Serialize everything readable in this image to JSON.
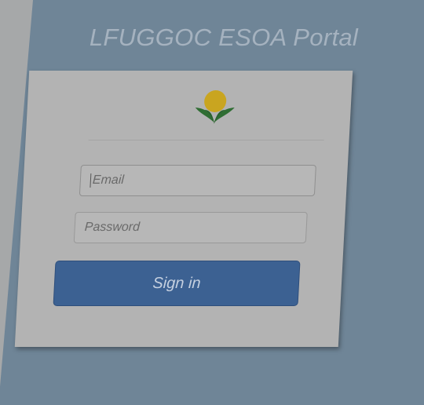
{
  "header": {
    "title": "LFUGGOC ESOA Portal"
  },
  "login": {
    "email_placeholder": "Email",
    "password_placeholder": "Password",
    "signin_label": "Sign in",
    "logo": "org-logo-sun-leaf-icon"
  },
  "colors": {
    "background": "#a6a8a9",
    "panel": "#6f8597",
    "card": "#b3b3b3",
    "button": "#3c6192",
    "title": "#a5b2bf"
  }
}
